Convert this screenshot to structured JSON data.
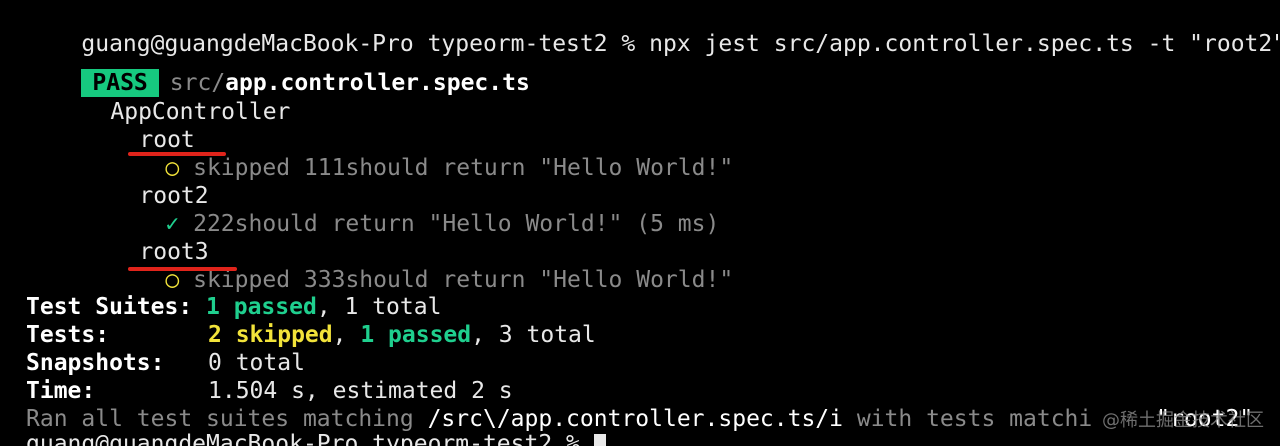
{
  "prompt_line": {
    "text": "guang@guangdeMacBook-Pro typeorm-test2 % npx jest src/app.controller.spec.ts -t \"root2\""
  },
  "pass_line": {
    "badge": "PASS",
    "path_prefix": "src/",
    "file_name": "app.controller.spec.ts"
  },
  "tree": {
    "suite": "AppController",
    "groups": [
      {
        "name": "root",
        "status_icon": "○",
        "status_text": "skipped",
        "test_name": "111should return \"Hello World!\"",
        "duration": ""
      },
      {
        "name": "root2",
        "status_icon": "✓",
        "status_text": "",
        "test_name": "222should return \"Hello World!\"",
        "duration": "(5 ms)"
      },
      {
        "name": "root3",
        "status_icon": "○",
        "status_text": "skipped",
        "test_name": "333should return \"Hello World!\"",
        "duration": ""
      }
    ]
  },
  "summary": {
    "suites_label": "Test Suites:",
    "suites_passed": "1 passed",
    "suites_total": ", 1 total",
    "tests_label": "Tests:",
    "tests_skipped": "2 skipped",
    "tests_sep": ", ",
    "tests_passed": "1 passed",
    "tests_total": ", 3 total",
    "snapshots_label": "Snapshots:",
    "snapshots_value": "0 total",
    "time_label": "Time:",
    "time_value": "1.504 s, estimated 2 s"
  },
  "ran_line": {
    "prefix": "Ran all test suites matching ",
    "pattern": "/src\\/app.controller.spec.ts/i",
    "middle": " with tests matchi",
    "filter": "\"root2\""
  },
  "last_prompt": {
    "text": "guang@guangdeMacBook-Pro typeorm-test2 % "
  },
  "watermark": {
    "text": "@稀土掘金技术社区"
  },
  "colors": {
    "background": "#000000",
    "pass_badge": "#16c97f",
    "green": "#1fcf8e",
    "yellow": "#f2e33a",
    "annotation_red": "#e0241b",
    "dim_gray": "#8a8a8a"
  }
}
